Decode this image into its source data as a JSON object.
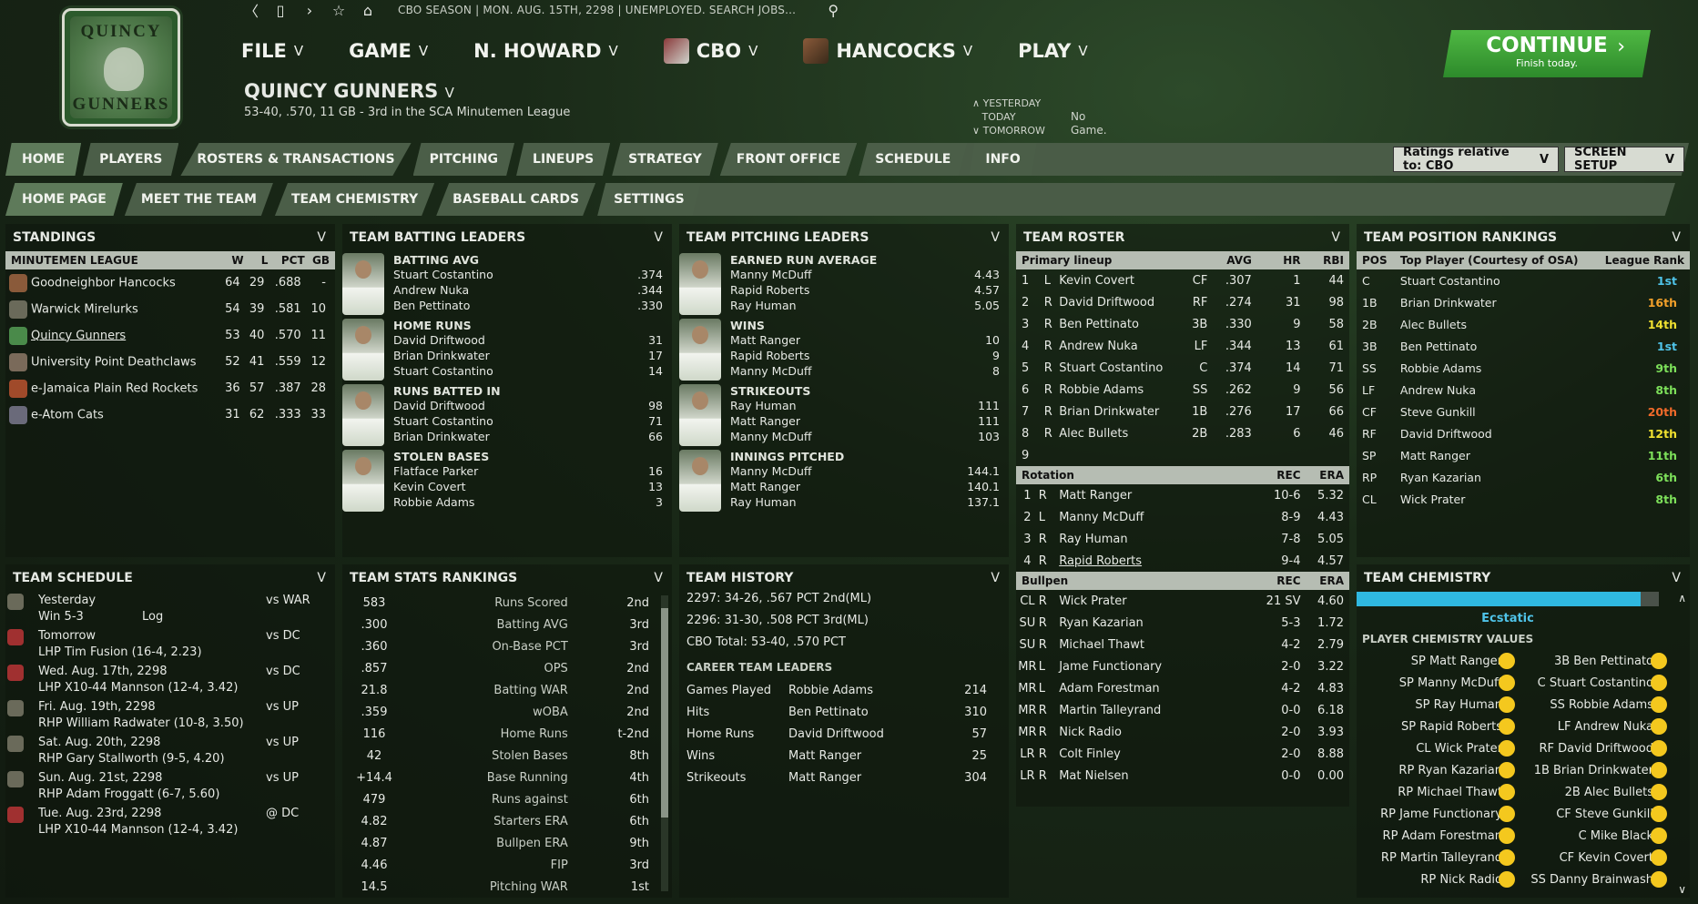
{
  "logo": {
    "line1": "QUINCY",
    "line2": "GUNNERS"
  },
  "topbar": {
    "info": "CBO SEASON  |  MON. AUG. 15TH, 2298  |  UNEMPLOYED. SEARCH JOBS..."
  },
  "menu": [
    {
      "label": "FILE"
    },
    {
      "label": "GAME"
    },
    {
      "label": "N. HOWARD"
    },
    {
      "label": "CBO"
    },
    {
      "label": "HANCOCKS"
    },
    {
      "label": "PLAY"
    }
  ],
  "team": {
    "name": "QUINCY GUNNERS",
    "sub": "53-40, .570, 11 GB - 3rd in the SCA Minutemen League"
  },
  "days": {
    "yesterday": "YESTERDAY",
    "today": "TODAY",
    "tomorrow": "TOMORROW",
    "today_text": "No Game."
  },
  "continue": {
    "label": "CONTINUE",
    "sub": "Finish today."
  },
  "tabs": [
    "HOME",
    "PLAYERS",
    "ROSTERS & TRANSACTIONS",
    "PITCHING",
    "LINEUPS",
    "STRATEGY",
    "FRONT OFFICE",
    "SCHEDULE",
    "INFO"
  ],
  "subtabs": [
    "HOME PAGE",
    "MEET THE TEAM",
    "TEAM CHEMISTRY",
    "BASEBALL CARDS",
    "SETTINGS"
  ],
  "controls": {
    "ratings": "Ratings relative to: CBO",
    "setup": "SCREEN SETUP"
  },
  "standings": {
    "title": "STANDINGS",
    "cols": [
      "MINUTEMEN LEAGUE",
      "W",
      "L",
      "PCT",
      "GB"
    ],
    "rows": [
      [
        "Goodneighbor Hancocks",
        "64",
        "29",
        ".688",
        "-"
      ],
      [
        "Warwick Mirelurks",
        "54",
        "39",
        ".581",
        "10"
      ],
      [
        "Quincy Gunners",
        "53",
        "40",
        ".570",
        "11"
      ],
      [
        "University Point Deathclaws",
        "52",
        "41",
        ".559",
        "12"
      ],
      [
        "e-Jamaica Plain Red Rockets",
        "36",
        "57",
        ".387",
        "28"
      ],
      [
        "e-Atom Cats",
        "31",
        "62",
        ".333",
        "33"
      ]
    ]
  },
  "batting": {
    "title": "TEAM BATTING LEADERS",
    "groups": [
      {
        "name": "BATTING AVG",
        "rows": [
          [
            "Stuart Costantino",
            ".374"
          ],
          [
            "Andrew Nuka",
            ".344"
          ],
          [
            "Ben Pettinato",
            ".330"
          ]
        ]
      },
      {
        "name": "HOME RUNS",
        "rows": [
          [
            "David Driftwood",
            "31"
          ],
          [
            "Brian Drinkwater",
            "17"
          ],
          [
            "Stuart Costantino",
            "14"
          ]
        ]
      },
      {
        "name": "RUNS BATTED IN",
        "rows": [
          [
            "David Driftwood",
            "98"
          ],
          [
            "Stuart Costantino",
            "71"
          ],
          [
            "Brian Drinkwater",
            "66"
          ]
        ]
      },
      {
        "name": "STOLEN BASES",
        "rows": [
          [
            "Flatface Parker",
            "16"
          ],
          [
            "Kevin Covert",
            "13"
          ],
          [
            "Robbie Adams",
            "3"
          ]
        ]
      }
    ]
  },
  "pitching": {
    "title": "TEAM PITCHING LEADERS",
    "groups": [
      {
        "name": "EARNED RUN AVERAGE",
        "rows": [
          [
            "Manny McDuff",
            "4.43"
          ],
          [
            "Rapid Roberts",
            "4.57"
          ],
          [
            "Ray Human",
            "5.05"
          ]
        ]
      },
      {
        "name": "WINS",
        "rows": [
          [
            "Matt Ranger",
            "10"
          ],
          [
            "Rapid Roberts",
            "9"
          ],
          [
            "Manny McDuff",
            "8"
          ]
        ]
      },
      {
        "name": "STRIKEOUTS",
        "rows": [
          [
            "Ray Human",
            "111"
          ],
          [
            "Matt Ranger",
            "111"
          ],
          [
            "Manny McDuff",
            "103"
          ]
        ]
      },
      {
        "name": "INNINGS PITCHED",
        "rows": [
          [
            "Manny McDuff",
            "144.1"
          ],
          [
            "Matt Ranger",
            "140.1"
          ],
          [
            "Ray Human",
            "137.1"
          ]
        ]
      }
    ]
  },
  "roster": {
    "title": "TEAM ROSTER",
    "lineup_head": [
      "Primary lineup",
      "AVG",
      "HR",
      "RBI"
    ],
    "lineup": [
      [
        "1",
        "L",
        "Kevin Covert",
        "CF",
        ".307",
        "1",
        "44"
      ],
      [
        "2",
        "R",
        "David Driftwood",
        "RF",
        ".274",
        "31",
        "98"
      ],
      [
        "3",
        "R",
        "Ben Pettinato",
        "3B",
        ".330",
        "9",
        "58"
      ],
      [
        "4",
        "R",
        "Andrew Nuka",
        "LF",
        ".344",
        "13",
        "61"
      ],
      [
        "5",
        "R",
        "Stuart Costantino",
        "C",
        ".374",
        "14",
        "71"
      ],
      [
        "6",
        "R",
        "Robbie Adams",
        "SS",
        ".262",
        "9",
        "56"
      ],
      [
        "7",
        "R",
        "Brian Drinkwater",
        "1B",
        ".276",
        "17",
        "66"
      ],
      [
        "8",
        "R",
        "Alec Bullets",
        "2B",
        ".283",
        "6",
        "46"
      ],
      [
        "9",
        "",
        "",
        "",
        "",
        "",
        ""
      ]
    ],
    "rotation_head": [
      "Rotation",
      "REC",
      "ERA"
    ],
    "rotation": [
      [
        "1",
        "R",
        "Matt Ranger",
        "10-6",
        "5.32"
      ],
      [
        "2",
        "L",
        "Manny McDuff",
        "8-9",
        "4.43"
      ],
      [
        "3",
        "R",
        "Ray Human",
        "7-8",
        "5.05"
      ],
      [
        "4",
        "R",
        "Rapid Roberts",
        "9-4",
        "4.57"
      ]
    ],
    "bullpen_head": [
      "Bullpen",
      "REC",
      "ERA"
    ],
    "bullpen": [
      [
        "CL",
        "R",
        "Wick Prater",
        "21 SV",
        "4.60"
      ],
      [
        "SU",
        "R",
        "Ryan Kazarian",
        "5-3",
        "1.72"
      ],
      [
        "SU",
        "R",
        "Michael Thawt",
        "4-2",
        "2.79"
      ],
      [
        "MR",
        "L",
        "Jame Functionary",
        "2-0",
        "3.22"
      ],
      [
        "MR",
        "L",
        "Adam Forestman",
        "4-2",
        "4.83"
      ],
      [
        "MR",
        "R",
        "Martin Talleyrand",
        "0-0",
        "6.18"
      ],
      [
        "MR",
        "R",
        "Nick Radio",
        "2-0",
        "3.93"
      ],
      [
        "LR",
        "R",
        "Colt Finley",
        "2-0",
        "8.88"
      ],
      [
        "LR",
        "R",
        "Mat Nielsen",
        "0-0",
        "0.00"
      ]
    ]
  },
  "positions": {
    "title": "TEAM POSITION RANKINGS",
    "head": [
      "POS",
      "Top Player (Courtesy of OSA)",
      "League Rank"
    ],
    "rows": [
      [
        "C",
        "Stuart Costantino",
        "1st",
        "#4fc3e8"
      ],
      [
        "1B",
        "Brian Drinkwater",
        "16th",
        "#f2a02a"
      ],
      [
        "2B",
        "Alec Bullets",
        "14th",
        "#f0e030"
      ],
      [
        "3B",
        "Ben Pettinato",
        "1st",
        "#4fc3e8"
      ],
      [
        "SS",
        "Robbie Adams",
        "9th",
        "#7de05a"
      ],
      [
        "LF",
        "Andrew Nuka",
        "8th",
        "#7de05a"
      ],
      [
        "CF",
        "Steve Gunkill",
        "20th",
        "#f06a2a"
      ],
      [
        "RF",
        "David Driftwood",
        "12th",
        "#f0e030"
      ],
      [
        "SP",
        "Matt Ranger",
        "11th",
        "#7de05a"
      ],
      [
        "RP",
        "Ryan Kazarian",
        "6th",
        "#7de05a"
      ],
      [
        "CL",
        "Wick Prater",
        "8th",
        "#7de05a"
      ]
    ]
  },
  "schedule": {
    "title": "TEAM SCHEDULE",
    "rows": [
      {
        "day": "Yesterday",
        "opp": "vs WAR",
        "detail": "Win 5-3",
        "log": "Log"
      },
      {
        "day": "Tomorrow",
        "opp": "vs DC",
        "detail": "LHP Tim Fusion (16-4, 2.23)"
      },
      {
        "day": "Wed. Aug. 17th, 2298",
        "opp": "vs DC",
        "detail": "LHP X10-44 Mannson (12-4, 3.42)"
      },
      {
        "day": "Fri. Aug. 19th, 2298",
        "opp": "vs UP",
        "detail": "RHP William Radwater (10-8, 3.50)"
      },
      {
        "day": "Sat. Aug. 20th, 2298",
        "opp": "vs UP",
        "detail": "RHP Gary Stallworth (9-5, 4.20)"
      },
      {
        "day": "Sun. Aug. 21st, 2298",
        "opp": "vs UP",
        "detail": "RHP Adam Froggatt (6-7, 5.60)"
      },
      {
        "day": "Tue. Aug. 23rd, 2298",
        "opp": "@ DC",
        "detail": "LHP X10-44 Mannson (12-4, 3.42)"
      }
    ]
  },
  "stats": {
    "title": "TEAM STATS RANKINGS",
    "rows": [
      [
        "583",
        "Runs Scored",
        "2nd"
      ],
      [
        ".300",
        "Batting AVG",
        "3rd"
      ],
      [
        ".360",
        "On-Base PCT",
        "3rd"
      ],
      [
        ".857",
        "OPS",
        "2nd"
      ],
      [
        "21.8",
        "Batting WAR",
        "2nd"
      ],
      [
        ".359",
        "wOBA",
        "2nd"
      ],
      [
        "116",
        "Home Runs",
        "t-2nd"
      ],
      [
        "42",
        "Stolen Bases",
        "8th"
      ],
      [
        "+14.4",
        "Base Running",
        "4th"
      ],
      [
        "479",
        "Runs against",
        "6th"
      ],
      [
        "4.82",
        "Starters ERA",
        "6th"
      ],
      [
        "4.87",
        "Bullpen ERA",
        "9th"
      ],
      [
        "4.46",
        "FIP",
        "3rd"
      ],
      [
        "14.5",
        "Pitching WAR",
        "1st"
      ]
    ]
  },
  "history": {
    "title": "TEAM HISTORY",
    "lines": [
      "2297: 34-26, .567 PCT 2nd(ML)",
      "2296: 31-30, .508 PCT 3rd(ML)",
      "CBO Total: 53-40, .570 PCT"
    ],
    "leaders_title": "CAREER TEAM LEADERS",
    "leaders": [
      [
        "Games Played",
        "Robbie Adams",
        "214"
      ],
      [
        "Hits",
        "Ben Pettinato",
        "310"
      ],
      [
        "Home Runs",
        "David Driftwood",
        "57"
      ],
      [
        "Wins",
        "Matt Ranger",
        "25"
      ],
      [
        "Strikeouts",
        "Matt Ranger",
        "304"
      ]
    ]
  },
  "chemistry": {
    "title": "TEAM CHEMISTRY",
    "level": 0.94,
    "state": "Ecstatic",
    "values_title": "PLAYER CHEMISTRY VALUES",
    "rows": [
      [
        "SP Matt Ranger",
        "3B Ben Pettinato"
      ],
      [
        "SP Manny McDuff",
        "C Stuart Costantino"
      ],
      [
        "SP Ray Human",
        "SS Robbie Adams"
      ],
      [
        "SP Rapid Roberts",
        "LF Andrew Nuka"
      ],
      [
        "CL Wick Prater",
        "RF David Driftwood"
      ],
      [
        "RP Ryan Kazarian",
        "1B Brian Drinkwater"
      ],
      [
        "RP Michael Thawt",
        "2B Alec Bullets"
      ],
      [
        "RP Jame Functionary",
        "CF Steve Gunkill"
      ],
      [
        "RP Adam Forestman",
        "C Mike Black"
      ],
      [
        "RP Martin Talleyrand",
        "CF Kevin Covert"
      ],
      [
        "RP Nick Radio",
        "SS Danny Brainwash"
      ]
    ]
  }
}
